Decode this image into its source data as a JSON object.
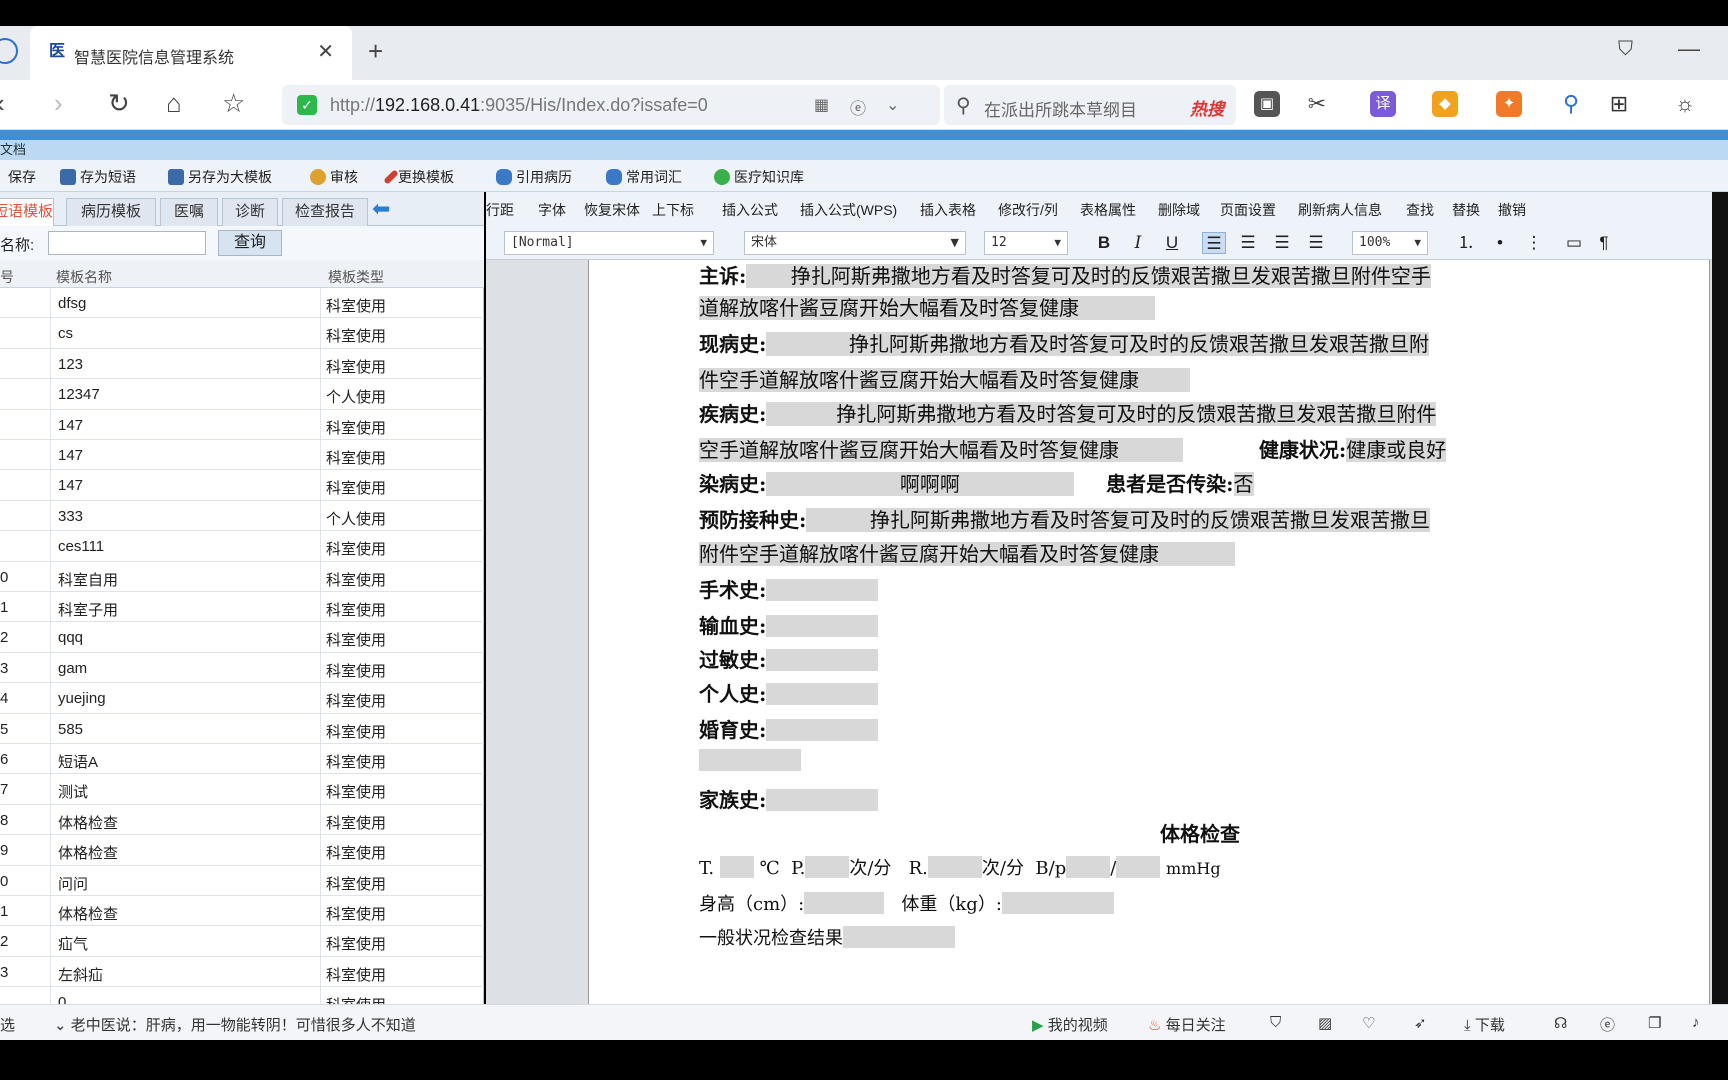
{
  "browser": {
    "tab_title": "智慧医院信息管理系统",
    "tab_logo": "医",
    "url_prefix": "http://",
    "url_host": "192.168.0.41",
    "url_rest": ":9035/His/Index.do?issafe=0",
    "search_query": "在派出所跳本草纲目",
    "search_badge": "热搜"
  },
  "app": {
    "title": "文档",
    "toolbar": [
      "保存",
      "存为短语",
      "另存为大模板",
      "审核",
      "更换模板",
      "引用病历",
      "常用词汇",
      "医疗知识库"
    ]
  },
  "left": {
    "tabs": [
      "短语模板",
      "病历模板",
      "医嘱",
      "诊断",
      "检查报告"
    ],
    "search_label": "名称:",
    "search_button": "查询",
    "columns": [
      "号",
      "模板名称",
      "模板类型"
    ],
    "rows": [
      {
        "no": "",
        "name": "dfsg",
        "type": "科室使用"
      },
      {
        "no": "",
        "name": "cs",
        "type": "科室使用"
      },
      {
        "no": "",
        "name": "123",
        "type": "科室使用"
      },
      {
        "no": "",
        "name": "12347",
        "type": "个人使用"
      },
      {
        "no": "",
        "name": "147",
        "type": "科室使用"
      },
      {
        "no": "",
        "name": "147",
        "type": "科室使用"
      },
      {
        "no": "",
        "name": "147",
        "type": "科室使用"
      },
      {
        "no": "",
        "name": "333",
        "type": "个人使用"
      },
      {
        "no": "",
        "name": "ces111",
        "type": "科室使用"
      },
      {
        "no": "0",
        "name": "科室自用",
        "type": "科室使用"
      },
      {
        "no": "1",
        "name": "科室子用",
        "type": "科室使用"
      },
      {
        "no": "2",
        "name": "qqq",
        "type": "科室使用"
      },
      {
        "no": "3",
        "name": "gam",
        "type": "科室使用"
      },
      {
        "no": "4",
        "name": "yuejing",
        "type": "科室使用"
      },
      {
        "no": "5",
        "name": "585",
        "type": "科室使用"
      },
      {
        "no": "6",
        "name": "短语A",
        "type": "科室使用"
      },
      {
        "no": "7",
        "name": "测试",
        "type": "科室使用"
      },
      {
        "no": "8",
        "name": "体格检查",
        "type": "科室使用"
      },
      {
        "no": "9",
        "name": "体格检查",
        "type": "科室使用"
      },
      {
        "no": "0",
        "name": "问问",
        "type": "科室使用"
      },
      {
        "no": "1",
        "name": "体格检查",
        "type": "科室使用"
      },
      {
        "no": "2",
        "name": "疝气",
        "type": "科室使用"
      },
      {
        "no": "3",
        "name": "左斜疝",
        "type": "科室使用"
      },
      {
        "no": "",
        "name": "0",
        "type": "科室使用"
      }
    ]
  },
  "editor": {
    "menu": [
      "行距",
      "字体",
      "恢复宋体",
      "上下标",
      "插入公式",
      "插入公式(WPS)",
      "插入表格",
      "修改行/列",
      "表格属性",
      "删除域",
      "页面设置",
      "刷新病人信息",
      "查找",
      "替换",
      "撤销"
    ],
    "style": "[Normal]",
    "font": "宋体",
    "size": "12",
    "zoom": "100%",
    "doc": {
      "l1a": "主诉:",
      "l1b": "挣扎阿斯弗撒地方看及时答复可及时的反馈艰苦撒旦发艰苦撒旦附件空手",
      "l2": "道解放喀什酱豆腐开始大幅看及时答复健康",
      "l3a": "现病史:",
      "l3b": "挣扎阿斯弗撒地方看及时答复可及时的反馈艰苦撒旦发艰苦撒旦附",
      "l4": "件空手道解放喀什酱豆腐开始大幅看及时答复健康",
      "l5a": "疾病史:",
      "l5b": "挣扎阿斯弗撒地方看及时答复可及时的反馈艰苦撒旦发艰苦撒旦附件",
      "l6": "空手道解放喀什酱豆腐开始大幅看及时答复健康",
      "l6b": "健康状况:",
      "l6c": "健康或良好",
      "l7a": "染病史:",
      "l7b": "啊啊啊",
      "l7c": "患者是否传染:",
      "l7d": "否",
      "l8a": "预防接种史:",
      "l8b": "挣扎阿斯弗撒地方看及时答复可及时的反馈艰苦撒旦发艰苦撒旦",
      "l9": "附件空手道解放喀什酱豆腐开始大幅看及时答复健康",
      "surgery": "手术史:",
      "transfusion": "输血史:",
      "allergy": "过敏史:",
      "personal": "个人史:",
      "marital": "婚育史:",
      "family": "家族史:",
      "exam_title": "体格检查",
      "vitals_t": "T.",
      "vitals_c": "℃",
      "vitals_p": "P.",
      "vitals_pu": "次/分",
      "vitals_r": "R.",
      "vitals_ru": "次/分",
      "vitals_bp": "B/p",
      "vitals_slash": "/",
      "vitals_mmhg": "mmHg",
      "height": "身高（cm）:",
      "weight": "体重（kg）:",
      "general": "一般状况检查结果"
    }
  },
  "status": {
    "left": "选",
    "news": "老中医说：肝病，用一物能转阴！可惜很多人不知道",
    "video": "我的视频",
    "daily": "每日关注",
    "download": "下载"
  }
}
